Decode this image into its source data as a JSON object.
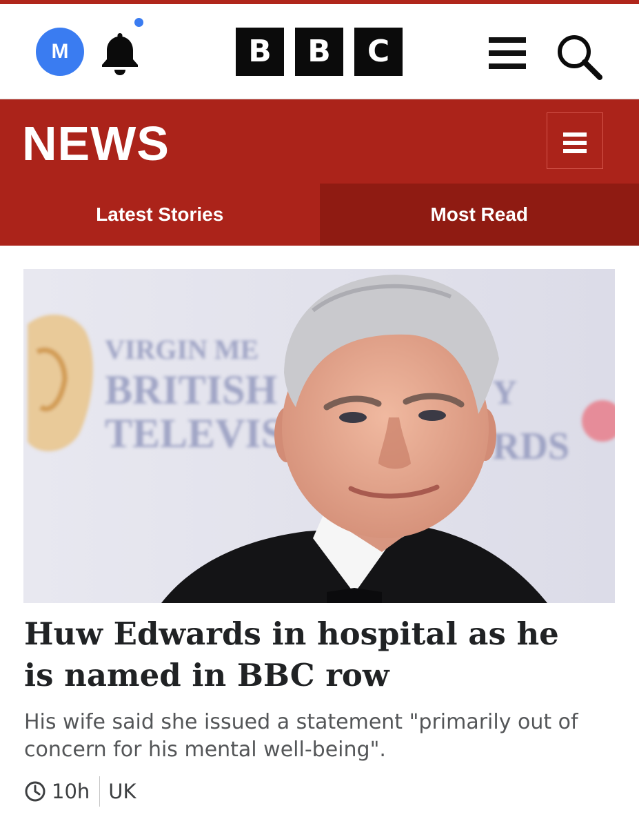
{
  "masthead": {
    "avatar_initial": "M",
    "logo_letters": [
      "B",
      "B",
      "C"
    ],
    "icons": {
      "bell": "bell-icon",
      "menu": "hamburger-menu-icon",
      "search": "search-icon"
    },
    "colors": {
      "avatar": "#3a7cf1",
      "notification_dot": "#3a7cf1",
      "logo_block": "#0b0b0b"
    }
  },
  "news_header": {
    "title": "NEWS",
    "menu_icon": "hamburger-menu-icon",
    "background_color": "#ab231a",
    "tabs": [
      {
        "label": "Latest Stories",
        "selected": false
      },
      {
        "label": "Most Read",
        "selected": true
      }
    ]
  },
  "article": {
    "headline": "Huw Edwards in hospital as he is named in BBC row",
    "summary": "His wife said she issued a statement \"primarily out of concern for his mental well-being\".",
    "age": "10h",
    "section": "UK",
    "image_backdrop_text": [
      "VIRGIN ME",
      "BRITISH",
      "TELEVIS",
      "Y",
      "RDS"
    ]
  }
}
